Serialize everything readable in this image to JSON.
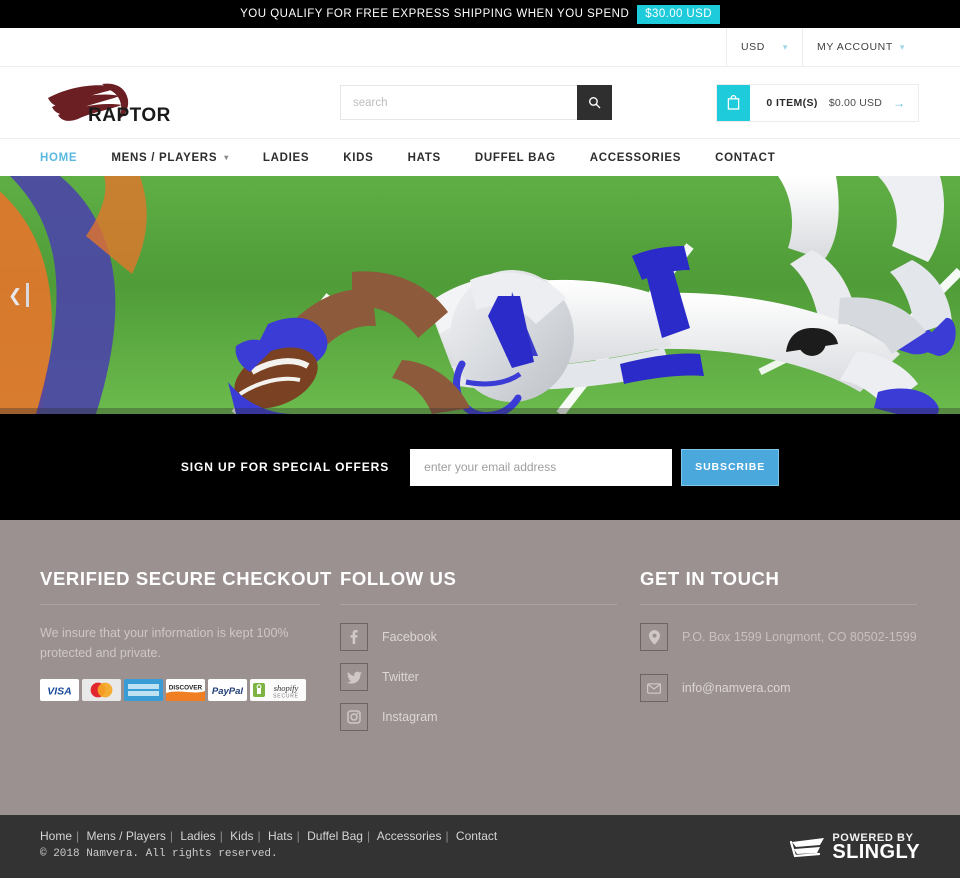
{
  "promo": {
    "text": "YOU QUALIFY FOR FREE EXPRESS SHIPPING WHEN YOU SPEND",
    "badge": "$30.00 USD",
    "badge_color": "#1ecbdb"
  },
  "utility": {
    "currency": "USD",
    "account": "MY ACCOUNT",
    "chevron_icon": "chevron-down-icon"
  },
  "header": {
    "logo_text": "RAPTORS",
    "logo_icon": "raptor-claw-icon",
    "logo_color": "#6b1f22",
    "search": {
      "placeholder": "search",
      "value": "",
      "button_icon": "search-icon"
    },
    "cart": {
      "icon": "shopping-bag-icon",
      "count_label": "0 ITEM(S)",
      "total": "$0.00 USD",
      "arrow_icon": "arrow-right-icon",
      "accent": "#1ecbdb"
    }
  },
  "nav": {
    "items": [
      {
        "label": "HOME",
        "active": true,
        "has_dropdown": false
      },
      {
        "label": "MENS / PLAYERS",
        "active": false,
        "has_dropdown": true
      },
      {
        "label": "LADIES",
        "active": false,
        "has_dropdown": false
      },
      {
        "label": "KIDS",
        "active": false,
        "has_dropdown": false
      },
      {
        "label": "HATS",
        "active": false,
        "has_dropdown": false
      },
      {
        "label": "DUFFEL BAG",
        "active": false,
        "has_dropdown": false
      },
      {
        "label": "ACCESSORIES",
        "active": false,
        "has_dropdown": false
      },
      {
        "label": "CONTACT",
        "active": false,
        "has_dropdown": false
      }
    ],
    "active_color": "#5ab9e0"
  },
  "hero": {
    "alt": "Football player diving across the goal line holding a football",
    "prev_icon": "chevron-left-icon"
  },
  "newsletter": {
    "label": "SIGN UP FOR SPECIAL OFFERS",
    "placeholder": "enter your email address",
    "value": "",
    "button": "SUBSCRIBE",
    "button_color": "#4aa8dd"
  },
  "footer": {
    "background": "#9a9190",
    "col1": {
      "heading": "VERIFIED SECURE CHECKOUT",
      "text": "We insure that your information is kept 100% protected and private.",
      "payments": [
        "VISA",
        "MasterCard",
        "AMERICAN EXPRESS",
        "DISCOVER",
        "PayPal",
        "shopify SECURE"
      ]
    },
    "col2": {
      "heading": "FOLLOW US",
      "links": [
        {
          "label": "Facebook",
          "icon": "facebook-icon"
        },
        {
          "label": "Twitter",
          "icon": "twitter-icon"
        },
        {
          "label": "Instagram",
          "icon": "instagram-icon"
        }
      ]
    },
    "col3": {
      "heading": "GET IN TOUCH",
      "address": "P.O. Box 1599 Longmont, CO 80502-1599",
      "address_icon": "map-pin-icon",
      "email": "info@namvera.com",
      "email_icon": "envelope-icon"
    }
  },
  "bottom": {
    "links": [
      "Home",
      "Mens / Players",
      "Ladies",
      "Kids",
      "Hats",
      "Duffel Bag",
      "Accessories",
      "Contact"
    ],
    "copyright": "© 2018 Namvera. All rights reserved.",
    "powered_line1": "POWERED BY",
    "powered_line2": "SLINGLY",
    "powered_icon": "shopping-cart-icon"
  }
}
